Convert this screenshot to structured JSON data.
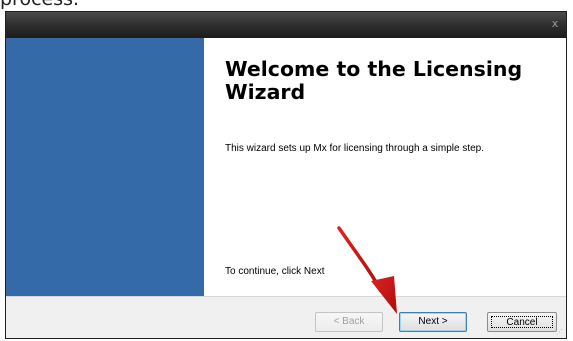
{
  "page": {
    "top_caption": "process."
  },
  "window": {
    "close_glyph": "x"
  },
  "wizard": {
    "title": "Welcome to the Licensing Wizard",
    "description": "This wizard sets up Mx for licensing through a simple step.",
    "continue_hint": "To continue, click Next",
    "side_panel_color": "#346aa8"
  },
  "buttons": {
    "back_label": "< Back",
    "back_enabled": false,
    "next_label": "Next >",
    "cancel_label": "Cancel"
  },
  "annotation": {
    "type": "red-arrow",
    "color": "#d11818",
    "points_to": "next-button"
  }
}
